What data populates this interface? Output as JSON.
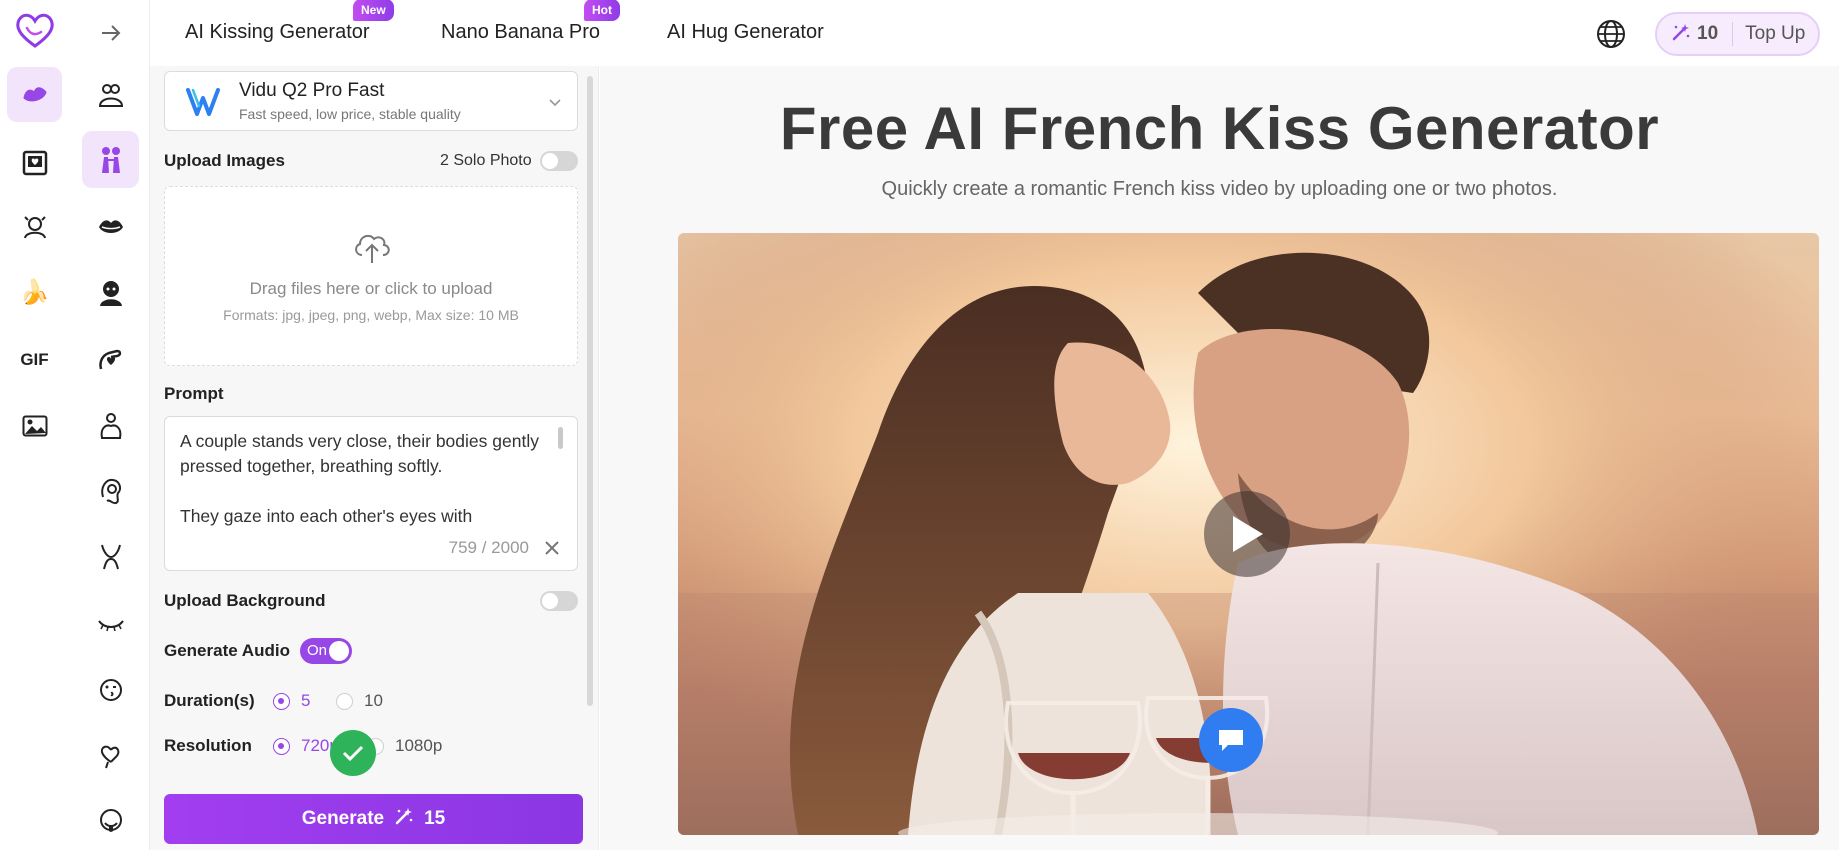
{
  "nav": {
    "links": [
      {
        "label": "AI Kissing Generator",
        "badge": "New"
      },
      {
        "label": "Nano Banana Pro",
        "badge": "Hot"
      },
      {
        "label": "AI Hug Generator",
        "badge": ""
      }
    ],
    "credits": "10",
    "top_up": "Top Up"
  },
  "rail": {
    "gif_label": "GIF"
  },
  "form": {
    "model_name": "Vidu Q2 Pro Fast",
    "model_desc": "Fast speed, low price, stable quality",
    "upload_images_label": "Upload Images",
    "solo_photo_label": "2 Solo Photo",
    "upload_text": "Drag files here or click to upload",
    "upload_formats": "Formats: jpg, jpeg, png, webp, Max size: 10 MB",
    "prompt_label": "Prompt",
    "prompt_text": "A couple stands very close, their bodies gently pressed together, breathing softly.\n\nThey gaze into each other's eyes with",
    "prompt_count": "759 / 2000",
    "upload_background_label": "Upload Background",
    "generate_audio_label": "Generate Audio",
    "audio_toggle": "On",
    "duration_label": "Duration(s)",
    "duration_options": [
      "5",
      "10"
    ],
    "resolution_label": "Resolution",
    "resolution_options": [
      "720p",
      "1080p"
    ],
    "generate_label": "Generate",
    "generate_cost": "15"
  },
  "hero": {
    "title": "Free AI French Kiss Generator",
    "subtitle": "Quickly create a romantic French kiss video by uploading one or two photos."
  },
  "colors": {
    "accent": "#9747e5",
    "accent_light": "#f1e4fb",
    "success": "#2fb35a",
    "chat": "#2f7df0"
  }
}
